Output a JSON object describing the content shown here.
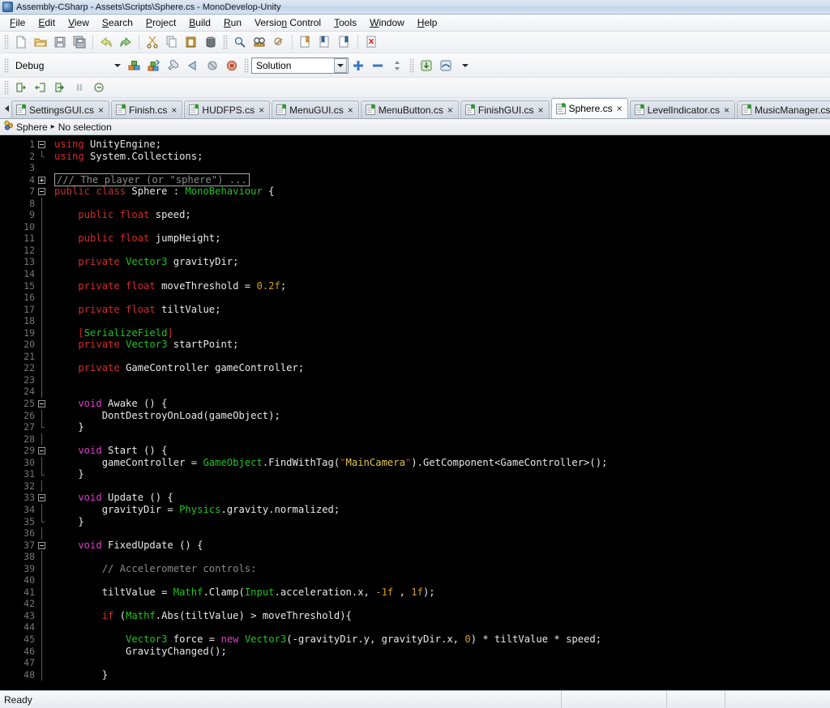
{
  "window": {
    "title": "Assembly-CSharp - Assets\\Scripts\\Sphere.cs - MonoDevelop-Unity",
    "icon": "monodevelop-icon"
  },
  "menubar": {
    "items": [
      {
        "label": "File",
        "mnemonic": "F"
      },
      {
        "label": "Edit",
        "mnemonic": "E"
      },
      {
        "label": "View",
        "mnemonic": "V"
      },
      {
        "label": "Search",
        "mnemonic": "S"
      },
      {
        "label": "Project",
        "mnemonic": "P"
      },
      {
        "label": "Build",
        "mnemonic": "B"
      },
      {
        "label": "Run",
        "mnemonic": "R"
      },
      {
        "label": "Version Control",
        "mnemonic": "n"
      },
      {
        "label": "Tools",
        "mnemonic": "T"
      },
      {
        "label": "Window",
        "mnemonic": "W"
      },
      {
        "label": "Help",
        "mnemonic": "H"
      }
    ]
  },
  "toolbar_main": {
    "groups": [
      [
        "new-file-icon",
        "open-file-icon",
        "save-file-icon",
        "save-all-icon"
      ],
      [
        "undo-icon",
        "redo-icon"
      ],
      [
        "cut-icon",
        "copy-icon",
        "paste-icon",
        "delete-icon"
      ],
      [
        "find-icon",
        "find-replace-icon",
        "find-next-icon"
      ],
      [
        "toggle-bookmark-icon",
        "previous-bookmark-icon",
        "next-bookmark-icon",
        "clear-bookmarks-icon"
      ]
    ]
  },
  "toolbar_run": {
    "configuration": {
      "value": "Debug",
      "label": "configuration-selector"
    },
    "buttons": [
      "build-solution-icon",
      "rebuild-solution-icon",
      "attach-to-process-icon",
      "run-icon",
      "stop-icon",
      "stop-build-icon"
    ],
    "scope": {
      "value": "Solution",
      "label": "scope-selector"
    },
    "zoom_buttons": [
      "zoom-in-icon",
      "zoom-out-icon",
      "zoom-reset-icon"
    ],
    "extra_buttons": [
      "step-into-project-icon",
      "step-over-project-icon",
      "overflow-chevron-icon"
    ]
  },
  "toolbar_debug": {
    "buttons": [
      "step-over-icon",
      "step-into-icon",
      "step-out-icon",
      "pause-icon",
      "continue-icon"
    ]
  },
  "tabs": {
    "scroll_left": "tab-scroll-left-icon",
    "items": [
      {
        "label": "SettingsGUI.cs",
        "active": false
      },
      {
        "label": "Finish.cs",
        "active": false
      },
      {
        "label": "HUDFPS.cs",
        "active": false
      },
      {
        "label": "MenuGUI.cs",
        "active": false
      },
      {
        "label": "MenuButton.cs",
        "active": false
      },
      {
        "label": "FinishGUI.cs",
        "active": false
      },
      {
        "label": "Sphere.cs",
        "active": true
      },
      {
        "label": "LevelIndicator.cs",
        "active": false
      },
      {
        "label": "MusicManager.cs",
        "active": false
      }
    ],
    "close_glyph": "×"
  },
  "breadcrumb": {
    "icon": "class-icon",
    "class": "Sphere",
    "separator": "▸",
    "member": "No selection"
  },
  "editor": {
    "file": "Sphere.cs",
    "first_line": 1,
    "last_line": 48,
    "lines": [
      {
        "n": 1,
        "fold": "open",
        "tokens": [
          {
            "t": "using ",
            "c": "kw"
          },
          {
            "t": "UnityEngine;",
            "c": "plain"
          }
        ]
      },
      {
        "n": 2,
        "fold": "end",
        "tokens": [
          {
            "t": "using ",
            "c": "kw"
          },
          {
            "t": "System.Collections;",
            "c": "plain"
          }
        ]
      },
      {
        "n": 3,
        "fold": "none",
        "tokens": []
      },
      {
        "n": 4,
        "fold": "plus",
        "folded": true,
        "tokens": [
          {
            "t": "/// The player (or \"sphere\") ...",
            "c": "cmt"
          }
        ]
      },
      {
        "n": 7,
        "fold": "open",
        "tokens": [
          {
            "t": "public class ",
            "c": "kw"
          },
          {
            "t": "Sphere",
            "c": "plain"
          },
          {
            "t": " : ",
            "c": "plain"
          },
          {
            "t": "MonoBehaviour",
            "c": "typ"
          },
          {
            "t": " {",
            "c": "plain"
          }
        ]
      },
      {
        "n": 8,
        "fold": "bar",
        "tokens": []
      },
      {
        "n": 9,
        "fold": "bar",
        "tokens": [
          {
            "t": "    public float ",
            "c": "kw"
          },
          {
            "t": "speed;",
            "c": "plain"
          }
        ]
      },
      {
        "n": 10,
        "fold": "bar",
        "tokens": []
      },
      {
        "n": 11,
        "fold": "bar",
        "tokens": [
          {
            "t": "    public float ",
            "c": "kw"
          },
          {
            "t": "jumpHeight;",
            "c": "plain"
          }
        ]
      },
      {
        "n": 12,
        "fold": "bar",
        "tokens": []
      },
      {
        "n": 13,
        "fold": "bar",
        "tokens": [
          {
            "t": "    private ",
            "c": "kw"
          },
          {
            "t": "Vector3",
            "c": "typ"
          },
          {
            "t": " gravityDir;",
            "c": "plain"
          }
        ]
      },
      {
        "n": 14,
        "fold": "bar",
        "tokens": []
      },
      {
        "n": 15,
        "fold": "bar",
        "tokens": [
          {
            "t": "    private float ",
            "c": "kw"
          },
          {
            "t": "moveThreshold = ",
            "c": "plain"
          },
          {
            "t": "0.2f",
            "c": "num"
          },
          {
            "t": ";",
            "c": "plain"
          }
        ]
      },
      {
        "n": 16,
        "fold": "bar",
        "tokens": []
      },
      {
        "n": 17,
        "fold": "bar",
        "tokens": [
          {
            "t": "    private float ",
            "c": "kw"
          },
          {
            "t": "tiltValue;",
            "c": "plain"
          }
        ]
      },
      {
        "n": 18,
        "fold": "bar",
        "tokens": []
      },
      {
        "n": 19,
        "fold": "bar",
        "tokens": [
          {
            "t": "    [",
            "c": "kw"
          },
          {
            "t": "SerializeField",
            "c": "typ"
          },
          {
            "t": "]",
            "c": "kw"
          }
        ]
      },
      {
        "n": 20,
        "fold": "bar",
        "tokens": [
          {
            "t": "    private ",
            "c": "kw"
          },
          {
            "t": "Vector3",
            "c": "typ"
          },
          {
            "t": " startPoint;",
            "c": "plain"
          }
        ]
      },
      {
        "n": 21,
        "fold": "bar",
        "tokens": []
      },
      {
        "n": 22,
        "fold": "bar",
        "tokens": [
          {
            "t": "    private ",
            "c": "kw"
          },
          {
            "t": "GameController gameController;",
            "c": "plain"
          }
        ]
      },
      {
        "n": 23,
        "fold": "bar",
        "tokens": []
      },
      {
        "n": 24,
        "fold": "bar",
        "tokens": []
      },
      {
        "n": 25,
        "fold": "open2",
        "tokens": [
          {
            "t": "    void ",
            "c": "kw2"
          },
          {
            "t": "Awake () {",
            "c": "plain"
          }
        ]
      },
      {
        "n": 26,
        "fold": "bar2",
        "tokens": [
          {
            "t": "        DontDestroyOnLoad(gameObject);",
            "c": "plain"
          }
        ]
      },
      {
        "n": 27,
        "fold": "end2",
        "tokens": [
          {
            "t": "    }",
            "c": "plain"
          }
        ]
      },
      {
        "n": 28,
        "fold": "bar",
        "tokens": []
      },
      {
        "n": 29,
        "fold": "open2",
        "tokens": [
          {
            "t": "    void ",
            "c": "kw2"
          },
          {
            "t": "Start () {",
            "c": "plain"
          }
        ]
      },
      {
        "n": 30,
        "fold": "bar2",
        "tokens": [
          {
            "t": "        gameController = ",
            "c": "plain"
          },
          {
            "t": "GameObject",
            "c": "typ"
          },
          {
            "t": ".FindWithTag(",
            "c": "plain"
          },
          {
            "t": "\"",
            "c": "strq"
          },
          {
            "t": "MainCamera",
            "c": "str"
          },
          {
            "t": "\"",
            "c": "strq"
          },
          {
            "t": ").GetComponent<GameController>();",
            "c": "plain"
          }
        ]
      },
      {
        "n": 31,
        "fold": "end2",
        "tokens": [
          {
            "t": "    }",
            "c": "plain"
          }
        ]
      },
      {
        "n": 32,
        "fold": "bar",
        "tokens": []
      },
      {
        "n": 33,
        "fold": "open2",
        "tokens": [
          {
            "t": "    void ",
            "c": "kw2"
          },
          {
            "t": "Update () {",
            "c": "plain"
          }
        ]
      },
      {
        "n": 34,
        "fold": "bar2",
        "tokens": [
          {
            "t": "        gravityDir = ",
            "c": "plain"
          },
          {
            "t": "Physics",
            "c": "typ"
          },
          {
            "t": ".gravity.normalized;",
            "c": "plain"
          }
        ]
      },
      {
        "n": 35,
        "fold": "end2",
        "tokens": [
          {
            "t": "    }",
            "c": "plain"
          }
        ]
      },
      {
        "n": 36,
        "fold": "bar",
        "tokens": []
      },
      {
        "n": 37,
        "fold": "open2",
        "tokens": [
          {
            "t": "    void ",
            "c": "kw2"
          },
          {
            "t": "FixedUpdate () {",
            "c": "plain"
          }
        ]
      },
      {
        "n": 38,
        "fold": "bar2",
        "tokens": []
      },
      {
        "n": 39,
        "fold": "bar2",
        "tokens": [
          {
            "t": "        // Accelerometer controls:",
            "c": "cmt"
          }
        ]
      },
      {
        "n": 40,
        "fold": "bar2",
        "tokens": []
      },
      {
        "n": 41,
        "fold": "bar2",
        "tokens": [
          {
            "t": "        tiltValue = ",
            "c": "plain"
          },
          {
            "t": "Mathf",
            "c": "typ"
          },
          {
            "t": ".Clamp(",
            "c": "plain"
          },
          {
            "t": "Input",
            "c": "typ"
          },
          {
            "t": ".acceleration.x, ",
            "c": "plain"
          },
          {
            "t": "-1f",
            "c": "num"
          },
          {
            "t": " , ",
            "c": "plain"
          },
          {
            "t": "1f",
            "c": "num"
          },
          {
            "t": ");",
            "c": "plain"
          }
        ]
      },
      {
        "n": 42,
        "fold": "bar2",
        "tokens": []
      },
      {
        "n": 43,
        "fold": "bar2",
        "tokens": [
          {
            "t": "        if ",
            "c": "kw"
          },
          {
            "t": "(",
            "c": "plain"
          },
          {
            "t": "Mathf",
            "c": "typ"
          },
          {
            "t": ".Abs(tiltValue) > moveThreshold){",
            "c": "plain"
          }
        ]
      },
      {
        "n": 44,
        "fold": "bar2",
        "tokens": []
      },
      {
        "n": 45,
        "fold": "bar2",
        "tokens": [
          {
            "t": "            ",
            "c": "plain"
          },
          {
            "t": "Vector3",
            "c": "typ"
          },
          {
            "t": " force = ",
            "c": "plain"
          },
          {
            "t": "new ",
            "c": "kw2"
          },
          {
            "t": "Vector3",
            "c": "typ"
          },
          {
            "t": "(-gravityDir.y, gravityDir.x, ",
            "c": "plain"
          },
          {
            "t": "0",
            "c": "num"
          },
          {
            "t": ") * tiltValue * speed;",
            "c": "plain"
          }
        ]
      },
      {
        "n": 46,
        "fold": "bar2",
        "tokens": [
          {
            "t": "            GravityChanged();",
            "c": "plain"
          }
        ]
      },
      {
        "n": 47,
        "fold": "bar2",
        "tokens": []
      },
      {
        "n": 48,
        "fold": "bar2",
        "tokens": [
          {
            "t": "        }",
            "c": "plain"
          }
        ]
      }
    ]
  },
  "statusbar": {
    "message": "Ready"
  },
  "colors": {
    "editor_background": "#000000",
    "editor_foreground": "#e8e8e8",
    "keyword": "#d22b2b",
    "keyword_modifier": "#e23ad0",
    "type": "#1fc41f",
    "number": "#d79b27",
    "string": "#e3c44d",
    "comment": "#8a8a8a",
    "line_number": "#767676",
    "chrome": "#eef1f5",
    "tab_active": "#ffffff"
  }
}
